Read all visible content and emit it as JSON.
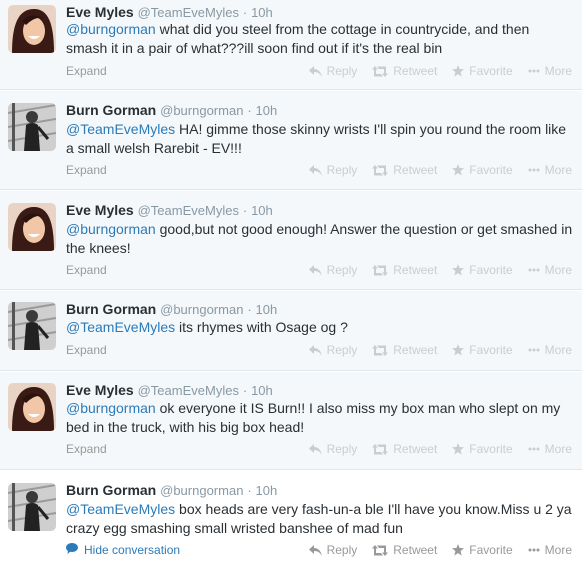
{
  "tweets": [
    {
      "author": "eve",
      "fullname": "Eve Myles",
      "username": "@TeamEveMyles",
      "time": "10h",
      "mention": "@burngorman",
      "text": " what did you steel from the cottage in countrycide, and then smash it in a pair of what???ill soon find out if it's the real bin",
      "footer_link": "Expand"
    },
    {
      "author": "burn",
      "fullname": "Burn Gorman",
      "username": "@burngorman",
      "time": "10h",
      "mention": "@TeamEveMyles",
      "text": " HA! gimme those skinny wrists I'll spin you round the room like a small welsh Rarebit - EV!!!",
      "footer_link": "Expand"
    },
    {
      "author": "eve",
      "fullname": "Eve Myles",
      "username": "@TeamEveMyles",
      "time": "10h",
      "mention": "@burngorman",
      "text": " good,but not good enough! Answer the question or get smashed in the knees!",
      "footer_link": "Expand"
    },
    {
      "author": "burn",
      "fullname": "Burn Gorman",
      "username": "@burngorman",
      "time": "10h",
      "mention": "@TeamEveMyles",
      "text": " its rhymes with Osage og ?",
      "footer_link": "Expand"
    },
    {
      "author": "eve",
      "fullname": "Eve Myles",
      "username": "@TeamEveMyles",
      "time": "10h",
      "mention": "@burngorman",
      "text": " ok everyone it IS Burn!! I also miss my box man who slept on my bed in the truck, with his big box head!",
      "footer_link": "Expand"
    },
    {
      "author": "burn",
      "fullname": "Burn Gorman",
      "username": "@burngorman",
      "time": "10h",
      "mention": "@TeamEveMyles",
      "text": " box heads are very fash-un-a ble I'll have you know.Miss u 2 ya crazy egg smashing small wristed banshee of mad fun",
      "footer_link": "Hide conversation"
    }
  ],
  "actions": {
    "reply": "Reply",
    "retweet": "Retweet",
    "favorite": "Favorite",
    "more": "More"
  },
  "separator": "·",
  "colors": {
    "link": "#2b7bb9",
    "muted": "#8899a6",
    "background_collapsed": "#f5f8fa",
    "border": "#e1e8ed"
  },
  "icons": [
    "reply-icon",
    "retweet-icon",
    "star-icon",
    "more-dots-icon",
    "speech-bubble-icon"
  ]
}
